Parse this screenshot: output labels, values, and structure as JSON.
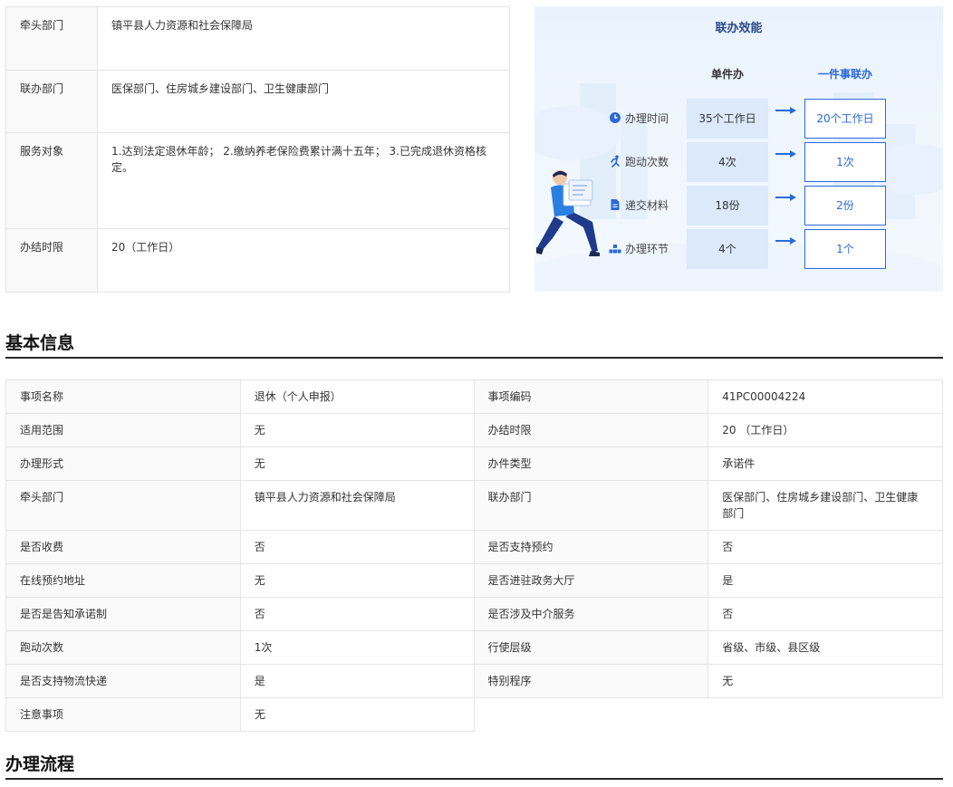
{
  "top_table": {
    "rows": [
      {
        "label": "牵头部门",
        "value": "镇平县人力资源和社会保障局"
      },
      {
        "label": "联办部门",
        "value": "医保部门、住房城乡建设部门、卫生健康部门"
      },
      {
        "label": "服务对象",
        "value": "1.达到法定退休年龄； 2.缴纳养老保险费累计满十五年； 3.已完成退休资格核定。"
      },
      {
        "label": "办结时限",
        "value": "20（工作日）"
      }
    ]
  },
  "panel": {
    "title": "联办效能",
    "col_single": "单件办",
    "col_joint": "一件事联办",
    "rows": [
      {
        "icon": "clock-icon",
        "label": "办理时间",
        "single": "35个工作日",
        "joint": "20个工作日"
      },
      {
        "icon": "running-icon",
        "label": "跑动次数",
        "single": "4次",
        "joint": "1次"
      },
      {
        "icon": "document-icon",
        "label": "递交材料",
        "single": "18份",
        "joint": "2份"
      },
      {
        "icon": "steps-icon",
        "label": "办理环节",
        "single": "4个",
        "joint": "1个"
      }
    ],
    "accent": "#2b6ad8"
  },
  "basic_info": {
    "title": "基本信息",
    "rows": [
      [
        {
          "label": "事项名称",
          "value": "退休（个人申报）"
        },
        {
          "label": "事项编码",
          "value": "41PC00004224"
        }
      ],
      [
        {
          "label": "适用范围",
          "value": "无"
        },
        {
          "label": "办结时限",
          "value": "20 （工作日）"
        }
      ],
      [
        {
          "label": "办理形式",
          "value": "无"
        },
        {
          "label": "办件类型",
          "value": "承诺件"
        }
      ],
      [
        {
          "label": "牵头部门",
          "value": "镇平县人力资源和社会保障局"
        },
        {
          "label": "联办部门",
          "value": "医保部门、住房城乡建设部门、卫生健康部门"
        }
      ],
      [
        {
          "label": "是否收费",
          "value": "否"
        },
        {
          "label": "是否支持预约",
          "value": "否"
        }
      ],
      [
        {
          "label": "在线预约地址",
          "value": "无"
        },
        {
          "label": "是否进驻政务大厅",
          "value": "是"
        }
      ],
      [
        {
          "label": "是否是告知承诺制",
          "value": "否"
        },
        {
          "label": "是否涉及中介服务",
          "value": "否"
        }
      ],
      [
        {
          "label": "跑动次数",
          "value": "1次"
        },
        {
          "label": "行使层级",
          "value": "省级、市级、县区级"
        }
      ],
      [
        {
          "label": "是否支持物流快递",
          "value": "是"
        },
        {
          "label": "特别程序",
          "value": "无"
        }
      ],
      [
        {
          "label": "注意事项",
          "value": "无"
        }
      ]
    ]
  },
  "process": {
    "title": "办理流程"
  }
}
